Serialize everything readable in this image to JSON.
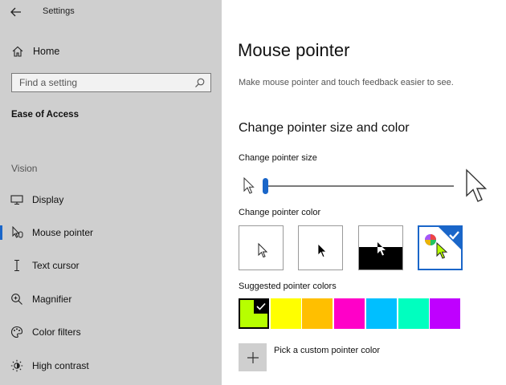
{
  "app": {
    "title": "Settings"
  },
  "sidebar": {
    "home": "Home",
    "search_placeholder": "Find a setting",
    "section": "Ease of Access",
    "group": "Vision",
    "items": [
      {
        "label": "Display",
        "icon": "display-icon",
        "active": false
      },
      {
        "label": "Mouse pointer",
        "icon": "mouse-pointer-icon",
        "active": true
      },
      {
        "label": "Text cursor",
        "icon": "text-cursor-icon",
        "active": false
      },
      {
        "label": "Magnifier",
        "icon": "magnifier-icon",
        "active": false
      },
      {
        "label": "Color filters",
        "icon": "color-filters-icon",
        "active": false
      },
      {
        "label": "High contrast",
        "icon": "high-contrast-icon",
        "active": false
      }
    ]
  },
  "main": {
    "title": "Mouse pointer",
    "description": "Make mouse pointer and touch feedback easier to see.",
    "subheading": "Change pointer size and color",
    "size_label": "Change pointer size",
    "size_value": 0,
    "color_label": "Change pointer color",
    "color_options": [
      {
        "name": "white",
        "selected": false
      },
      {
        "name": "black",
        "selected": false
      },
      {
        "name": "inverted",
        "selected": false
      },
      {
        "name": "custom",
        "selected": true
      }
    ],
    "suggested_label": "Suggested pointer colors",
    "suggested_colors": [
      "#b7ff00",
      "#ffff00",
      "#ffbf00",
      "#ff00c8",
      "#00bfff",
      "#00ffbf",
      "#bf00ff"
    ],
    "suggested_selected": 0,
    "custom_label": "Pick a custom pointer color"
  },
  "colors": {
    "accent": "#1a66c9",
    "sidebar_bg": "#cfcfcf"
  }
}
